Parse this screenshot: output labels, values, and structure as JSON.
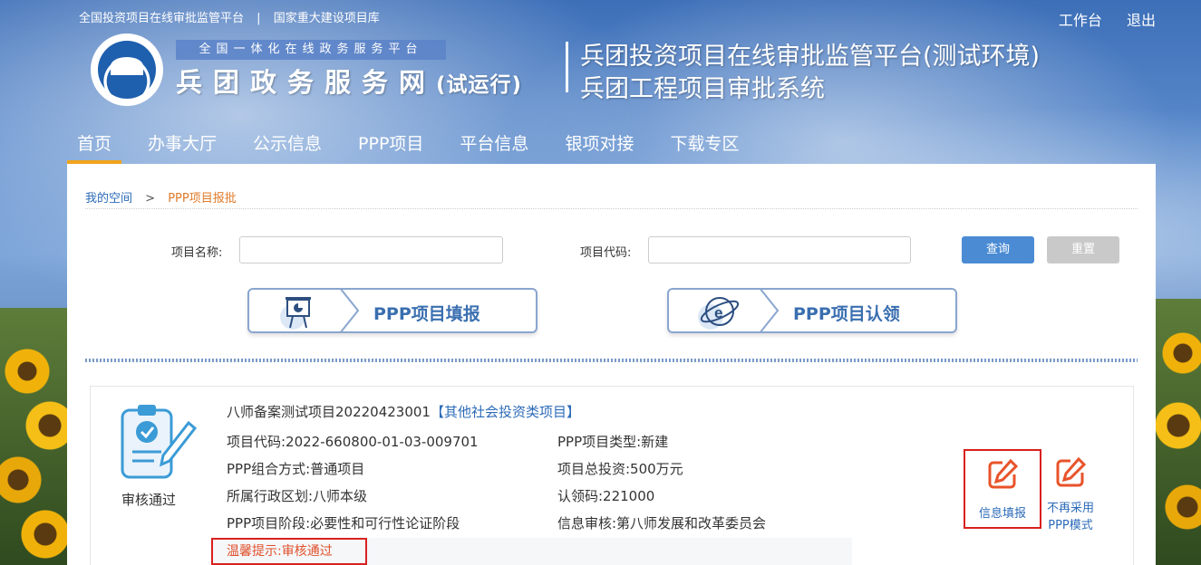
{
  "top": {
    "links": [
      "全国投资项目在线审批监管平台",
      "国家重大建设项目库"
    ],
    "sep": "|",
    "workbench": "工作台",
    "logout": "退出"
  },
  "brand": {
    "subtitle": "全国一体化在线政务服务平台",
    "title": "兵团政务服务网",
    "suffix": "(试运行)",
    "system_line1": "兵团投资项目在线审批监管平台(测试环境)",
    "system_line2": "兵团工程项目审批系统"
  },
  "nav": [
    "首页",
    "办事大厅",
    "公示信息",
    "PPP项目",
    "平台信息",
    "银项对接",
    "下载专区"
  ],
  "breadcrumb": {
    "home": "我的空间",
    "sep": ">",
    "current": "PPP项目报批"
  },
  "search": {
    "name_label": "项目名称:",
    "code_label": "项目代码:",
    "name_value": "",
    "code_value": "",
    "query": "查询",
    "reset": "重置"
  },
  "actions": {
    "fill": "PPP项目填报",
    "claim": "PPP项目认领"
  },
  "project": {
    "status": "审核通过",
    "name": "八师备案测试项目20220423001",
    "category": "【其他社会投资类项目】",
    "code": "项目代码:2022-660800-01-03-009701",
    "type": "PPP项目类型:新建",
    "combo": "PPP组合方式:普通项目",
    "investment": "项目总投资:500万元",
    "region": "所属行政区划:八师本级",
    "claim_code": "认领码:221000",
    "stage": "PPP项目阶段:必要性和可行性论证阶段",
    "review": "信息审核:第八师发展和改革委员会",
    "tip": "温馨提示:审核通过",
    "btn_fill": "信息填报",
    "btn_drop_line1": "不再采用",
    "btn_drop_line2": "PPP模式"
  },
  "colors": {
    "accent": "#2c6bb8",
    "nav_active": "#f0a31c",
    "highlight": "#d9201f"
  }
}
